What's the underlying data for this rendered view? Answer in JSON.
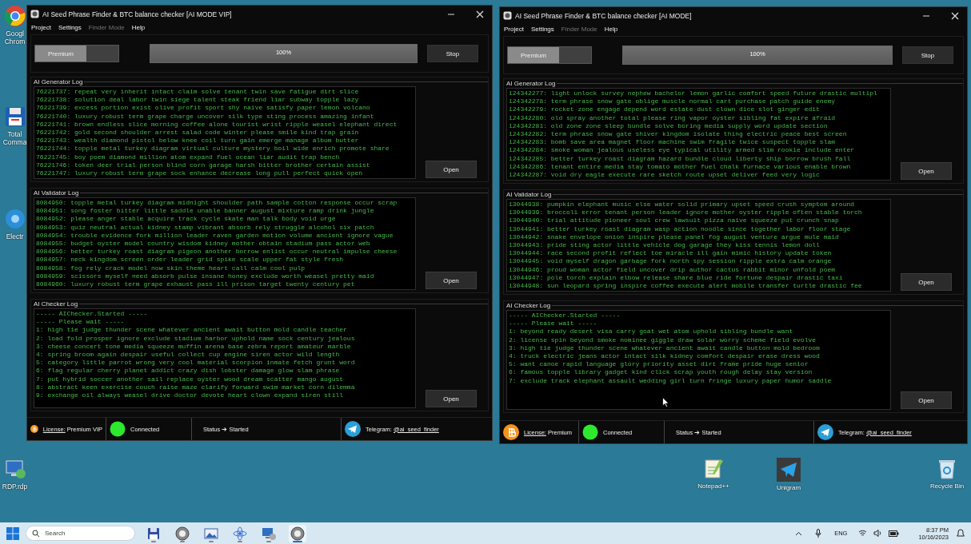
{
  "desktop_icons": [
    {
      "kind": "chrome",
      "label": "Googl Chrom"
    },
    {
      "kind": "commander",
      "label": "Total Comma"
    },
    {
      "kind": "electrum",
      "label": "Electr"
    },
    {
      "kind": "rdp",
      "label": "RDP.rdp"
    },
    {
      "kind": "notepad",
      "label": "Notepad++"
    },
    {
      "kind": "unigram",
      "label": "Unigram"
    },
    {
      "kind": "recycle",
      "label": "Recycle Bin"
    }
  ],
  "windows": [
    {
      "title": "AI Seed Phrase Finder & BTC balance checker [AI MODE VIP]",
      "menu": [
        {
          "label": "Project",
          "disabled": false
        },
        {
          "label": "Settings",
          "disabled": false
        },
        {
          "label": "Finder Mode",
          "disabled": true
        },
        {
          "label": "Help",
          "disabled": false
        }
      ],
      "toggle": {
        "label": "Premium",
        "on": true
      },
      "progress": {
        "label": "100%",
        "level": 1
      },
      "stop_button": "Stop",
      "logs": [
        {
          "title": "AI Generator Log",
          "button": "Open",
          "lines": [
            "76221737: repeat very inherit intact claim solve tenant twin save fatigue dirt slice",
            "76221738: solution deal labor twin siege talent steak friend liar subway topple lazy",
            "76221739: excess portion exist olive profit sport shy naive satisfy paper lemon volcano",
            "76221740: luxury robust term grape charge uncover silk type sting process amazing infant",
            "76221741: brown endless slice morning coffee alone tourist wrist ripple weasel elephant direct",
            "76221742: gold second shoulder arrest salad code winter please smile kind trap grain",
            "76221743: wealth diamond pistol below knee coil turn gain emerge manage album butter",
            "76221744: topple metal turkey diagram virtual culture mystery boil wide enrich promote share",
            "76221745: boy poem diamond million atom expand fuel ocean liar audit trap bench",
            "76221746: token deer trial person blind corn garage harsh bitter brother certain assist",
            "76221747: luxury robust term grape sock enhance decrease long pull perfect quick open"
          ]
        },
        {
          "title": "AI Validator Log",
          "button": "Open",
          "lines": [
            "8084950: topple metal turkey diagram midnight shoulder path sample cotton response occur scrap",
            "8084951: song foster bitter little saddle unable banner august mixture ramp drink jungle",
            "8084952: please anger stable acquire track cycle skate man talk body void urge",
            "8084953: quiz neutral actual kidney stamp vibrant absorb rely struggle alcohol six patch",
            "8084954: trouble evidence fork million leader raven garden motion volume ancient ignore vague",
            "8084955: budget oyster model country wisdom kidney mother obtain stadium pass actor web",
            "8084956: better turkey roast diagram pigeon another borrow enlist occur neutral impulse cheese",
            "8084957: neck kingdom screen order leader grid spike scale upper fat style fresh",
            "8084958: fog rely crack model now skin theme heart call calm cool pulp",
            "8084959: scissors myself need absorb pulse insane honey exclude worth weasel pretty maid",
            "8084960: luxury robust term grape exhaust pass ill prison target twenty century pet"
          ]
        },
        {
          "title": "AI Checker Log",
          "button": "Open",
          "lines": [
            "----- AIChecker.Started -----",
            "----- Please wait -----",
            "1: high tie judge thunder scene whatever ancient await button mold candle teacher",
            "2: load fold prosper ignore exclude stadium harbor uphold name sock century jealous",
            "3: cheese concert tone media squeeze muffin arena base zebra report amateur marble",
            "4: spring broom again despair useful collect cup engine siren actor wild length",
            "5: category little parrot wrong very cool material scorpion inmate fetch grunt word",
            "6: flag regular cherry planet addict crazy dish lobster damage glow slam phrase",
            "7: put hybrid soccer another sail replace oyster wood dream scatter mango august",
            "8: abstract keen exercise couch raise maze clarify forward swim market corn dilemma",
            "9: exchange oil always weasel drive doctor devote heart clown expand siren still"
          ]
        }
      ],
      "status": {
        "license_link": "License:",
        "license_value": "Premium VIP",
        "connection": "Connected",
        "connected": true,
        "state": "Status ➔ Started",
        "telegram_label": "Telegram:",
        "telegram_handle": "@ai_seed_finder"
      }
    },
    {
      "title": "AI Seed Phrase Finder & BTC balance checker [AI MODE]",
      "menu": [
        {
          "label": "Project",
          "disabled": false
        },
        {
          "label": "Settings",
          "disabled": false
        },
        {
          "label": "Finder Mode",
          "disabled": true
        },
        {
          "label": "Help",
          "disabled": false
        }
      ],
      "toggle": {
        "label": "Premium",
        "on": true
      },
      "progress": {
        "label": "100%",
        "level": 1
      },
      "stop_button": "Stop",
      "logs": [
        {
          "title": "AI Generator Log",
          "button": "Open",
          "lines": [
            "124342277: light unlock survey nephew bachelor lemon garlic comfort speed future drastic multipl",
            "124342278: term phrase snow gate oblige muscle normal cart purchase patch guide enemy",
            "124342279: rocket zone engage depend word estate dust clown dice slot ginger edit",
            "124342280: old spray another total please ring vapor oyster sibling fat expire afraid",
            "124342281: old zone zone sleep bundle solve boring media supply word update section",
            "124342282: term phrase snow gate shiver kingdom isolate thing electric peace best screen",
            "124342283: bomb save area magnet floor machine swim fragile twice suspect topple slam",
            "124342284: smoke woman jealous useless eye typical utility armed slim rookie include enter",
            "124342285: better turkey roast diagram hazard bundle cloud liberty ship borrow brush fall",
            "124342286: tenant entire media stay tomato mother fuel chalk furnace various enable brown",
            "124342287: void dry eagle execute rare sketch route upset deliver feed very logic"
          ]
        },
        {
          "title": "AI Validator Log",
          "button": "Open",
          "lines": [
            "13044938: pumpkin elephant music else water solid primary upset speed crush symptom around",
            "13044939: broccoli error tenant person leader ignore mother oyster ripple often stable torch",
            "13044940: trial attitude pioneer soul crew lawsuit pizza naive squeeze put crunch snap",
            "13044941: better turkey roast diagram wasp action noodle since together labor floor stage",
            "13044942: snake envelope onion inspire please panel fog august venture argue mule maid",
            "13044943: pride sting actor little vehicle dog garage they kiss tennis lemon doll",
            "13044944: race second profit reflect toe miracle ill gain mimic history update token",
            "13044945: void myself dragon garbage fork north spy session ripple extra calm orange",
            "13044946: proud woman actor field uncover drip author cactus rabbit minor unfold poem",
            "13044947: pole torch explain elbow release share blue ride fortune despair drastic taxi",
            "13044948: sun leopard spring inspire coffee execute alert mobile transfer turtle drastic fee"
          ]
        },
        {
          "title": "AI Checker Log",
          "button": "Open",
          "lines": [
            "----- AIChecker.Started -----",
            "----- Please wait -----",
            "1: beyond ready desert visa carry goat wet atom uphold sibling bundle want",
            "2: license spin beyond smoke nominee giggle draw solar worry scheme field evolve",
            "3: high tie judge thunder scene whatever ancient await candle button mold bedroom",
            "4: truck electric jeans actor intact silk kidney comfort despair erase dress wood",
            "5: want canoe rapid language glory priority asset dirt frame pride huge senior",
            "6: famous topple library gadget kind click scrap youth rough delay stay version",
            "7: exclude track elephant assault wedding girl turn fringe luxury paper humor saddle"
          ]
        }
      ],
      "status": {
        "license_link": "License:",
        "license_value": "Premium",
        "connection": "Connected",
        "connected": true,
        "state": "Status ➔ Started",
        "telegram_label": "Telegram:",
        "telegram_handle": "@ai_seed_finder"
      }
    }
  ],
  "taskbar": {
    "search_placeholder": "Search",
    "apps": [
      {
        "kind": "floppy",
        "active": false
      },
      {
        "kind": "disc",
        "active": false
      },
      {
        "kind": "image",
        "active": false
      },
      {
        "kind": "atom",
        "active": false
      },
      {
        "kind": "rdp",
        "active": false
      },
      {
        "kind": "disc",
        "active": true
      }
    ],
    "language": "ENG",
    "time": "8:37 PM",
    "date": "10/16/2023"
  }
}
